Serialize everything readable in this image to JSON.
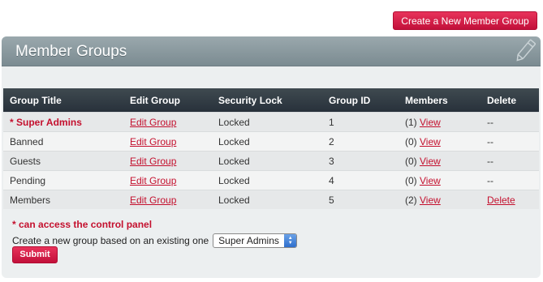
{
  "top_button": {
    "label": "Create a New Member Group"
  },
  "panel": {
    "title": "Member Groups"
  },
  "table": {
    "headers": [
      "Group Title",
      "Edit Group",
      "Security Lock",
      "Group ID",
      "Members",
      "Delete"
    ],
    "rows": [
      {
        "title": "* Super Admins",
        "edit": "Edit Group",
        "lock": "Locked",
        "id": "1",
        "count": "(1)",
        "view": "View",
        "delete": "--"
      },
      {
        "title": "Banned",
        "edit": "Edit Group",
        "lock": "Locked",
        "id": "2",
        "count": "(0)",
        "view": "View",
        "delete": "--"
      },
      {
        "title": "Guests",
        "edit": "Edit Group",
        "lock": "Locked",
        "id": "3",
        "count": "(0)",
        "view": "View",
        "delete": "--"
      },
      {
        "title": "Pending",
        "edit": "Edit Group",
        "lock": "Locked",
        "id": "4",
        "count": "(0)",
        "view": "View",
        "delete": "--"
      },
      {
        "title": "Members",
        "edit": "Edit Group",
        "lock": "Locked",
        "id": "5",
        "count": "(2)",
        "view": "View",
        "delete": "Delete"
      }
    ]
  },
  "footer": {
    "note": "* can access the control panel",
    "create_label": "Create a new group based on an existing one",
    "select_value": "Super Admins",
    "submit_label": "Submit"
  },
  "icons": {
    "header_icon": "pencil-icon",
    "select_arrows": "updown-arrows-icon"
  },
  "colors": {
    "accent": "#c4102e",
    "header_bg": "#2f3a41",
    "panel_head": "#8a999e"
  }
}
